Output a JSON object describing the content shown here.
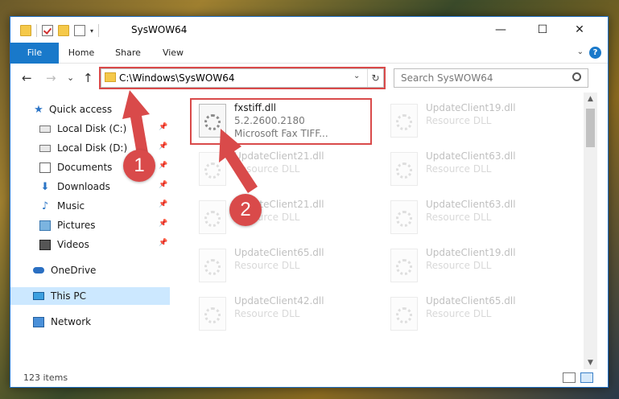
{
  "window": {
    "title": "SysWOW64",
    "minimize_glyph": "—",
    "maximize_glyph": "☐",
    "close_glyph": "✕"
  },
  "quick_access_toolbar": {
    "icons": [
      "folder-icon",
      "properties-check-icon",
      "new-folder-icon",
      "customize-icon"
    ]
  },
  "ribbon": {
    "tabs": [
      "File",
      "Home",
      "Share",
      "View"
    ],
    "help_label": "?"
  },
  "nav": {
    "back_glyph": "←",
    "forward_glyph": "→",
    "recent_glyph": "⌄",
    "up_glyph": "↑",
    "address": "C:\\Windows\\SysWOW64",
    "search_placeholder": "Search SysWOW64"
  },
  "sidebar": {
    "items": [
      {
        "label": "Quick access",
        "icon": "star-icon"
      },
      {
        "label": "Local Disk (C:)",
        "icon": "disk-icon",
        "pinned": true
      },
      {
        "label": "Local Disk (D:)",
        "icon": "disk-icon",
        "pinned": true
      },
      {
        "label": "Documents",
        "icon": "documents-icon",
        "pinned": true
      },
      {
        "label": "Downloads",
        "icon": "download-icon",
        "pinned": true
      },
      {
        "label": "Music",
        "icon": "music-icon",
        "pinned": true
      },
      {
        "label": "Pictures",
        "icon": "pictures-icon",
        "pinned": true
      },
      {
        "label": "Videos",
        "icon": "videos-icon",
        "pinned": true
      },
      {
        "label": "OneDrive",
        "icon": "cloud-icon"
      },
      {
        "label": "This PC",
        "icon": "pc-icon",
        "selected": true
      },
      {
        "label": "Network",
        "icon": "network-icon"
      }
    ]
  },
  "files": [
    {
      "name": "fxstiff.dll",
      "line2": "5.2.2600.2180",
      "line3": "Microsoft  Fax TIFF...",
      "highlighted": true
    },
    {
      "name": "UpdateClient19.dll",
      "line2": "Resource DLL"
    },
    {
      "name": "UpdateClient21.dll",
      "line2": "Resource DLL"
    },
    {
      "name": "UpdateClient63.dll",
      "line2": "Resource DLL"
    },
    {
      "name": "UpdateClient21.dll",
      "line2": "Resource DLL"
    },
    {
      "name": "UpdateClient63.dll",
      "line2": "Resource DLL"
    },
    {
      "name": "UpdateClient65.dll",
      "line2": "Resource DLL"
    },
    {
      "name": "UpdateClient19.dll",
      "line2": "Resource DLL"
    },
    {
      "name": "UpdateClient42.dll",
      "line2": "Resource DLL"
    },
    {
      "name": "UpdateClient65.dll",
      "line2": "Resource DLL"
    }
  ],
  "status": {
    "item_count": "123 items"
  },
  "annotations": {
    "step1": "1",
    "step2": "2",
    "highlight_color": "#d94a4a"
  }
}
